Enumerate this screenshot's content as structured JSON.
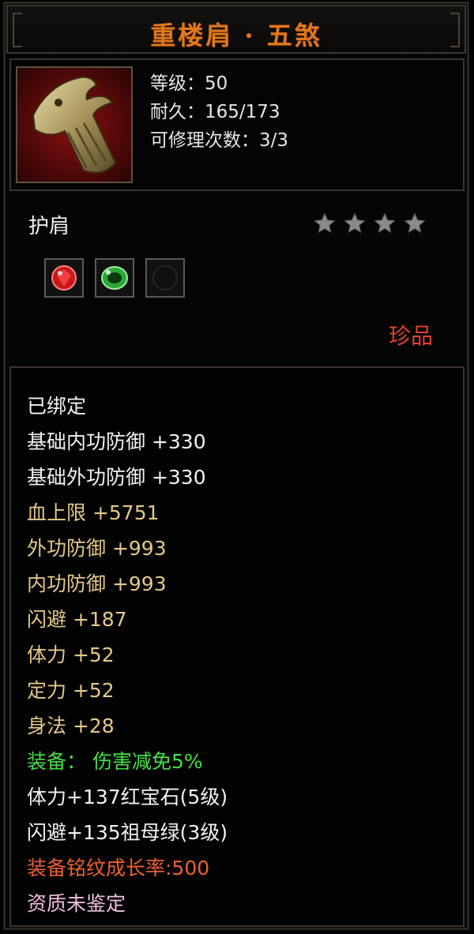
{
  "item": {
    "title": "重楼肩 · 五煞",
    "level": "等级：50",
    "durability": "耐久：165/173",
    "repair": "可修理次数：3/3",
    "type": "护肩",
    "stars": 4,
    "rarity": "珍品"
  },
  "gems": [
    {
      "name": "ruby-gem-icon",
      "color": "#c81818"
    },
    {
      "name": "emerald-gem-icon",
      "color": "#2aa838"
    },
    {
      "name": "empty-socket-icon",
      "color": "#101010"
    }
  ],
  "attributes": {
    "bound": "已绑定",
    "base_inner_def": "基础内功防御  +330",
    "base_outer_def": "基础外功防御  +330",
    "hp_max": "血上限  +5751",
    "outer_def": "外功防御  +993",
    "inner_def": "内功防御  +993",
    "dodge": "闪避  +187",
    "stamina": "体力  +52",
    "focus": "定力  +52",
    "agility": "身法  +28",
    "equip_bonus": "装备：  伤害减免5%",
    "gem_ruby": "体力+137红宝石(5级)",
    "gem_emerald": "闪避+135祖母绿(3级)",
    "inscription_growth": "装备铭纹成长率:500",
    "aptitude": "资质未鉴定"
  },
  "colors": {
    "title": "#e0781c",
    "white_attr": "#f2f2f2",
    "gold_attr": "#e4c888",
    "green_attr": "#44e044",
    "orange_attr": "#ec6030",
    "pink_attr": "#f0c0e0",
    "rarity": "#e04030"
  }
}
